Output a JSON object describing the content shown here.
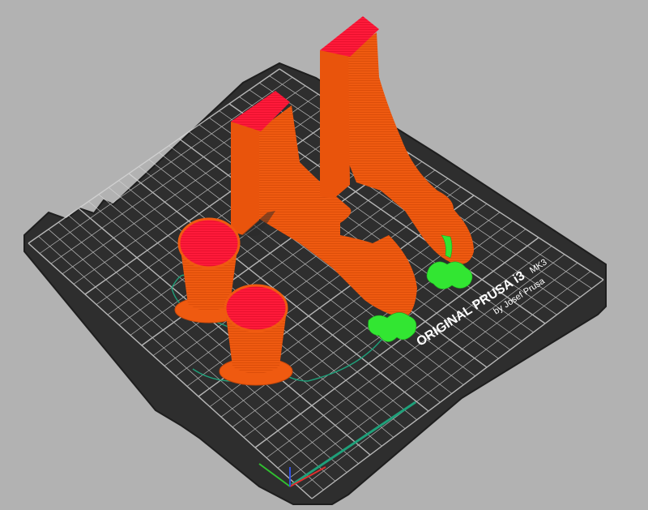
{
  "bed": {
    "logo_line1": "ORIGINAL PRUSA i3",
    "logo_model": "MK3",
    "logo_line2": "by Josef Prusa"
  },
  "colors": {
    "background": "#b2b2b2",
    "bed": "#2e2e2e",
    "grid": "#d8d8d8",
    "part_orange": "#ef5a10",
    "part_top_red": "#ff1a3a",
    "support_green": "#32e632",
    "skirt_green": "#1fa07a",
    "axis_x": "#e03030",
    "axis_y": "#30c030",
    "axis_z": "#3050e0"
  },
  "parts": [
    "tall-bracket-left",
    "tall-bracket-right",
    "cup-back",
    "cup-front"
  ],
  "axes": [
    "x",
    "y",
    "z"
  ]
}
